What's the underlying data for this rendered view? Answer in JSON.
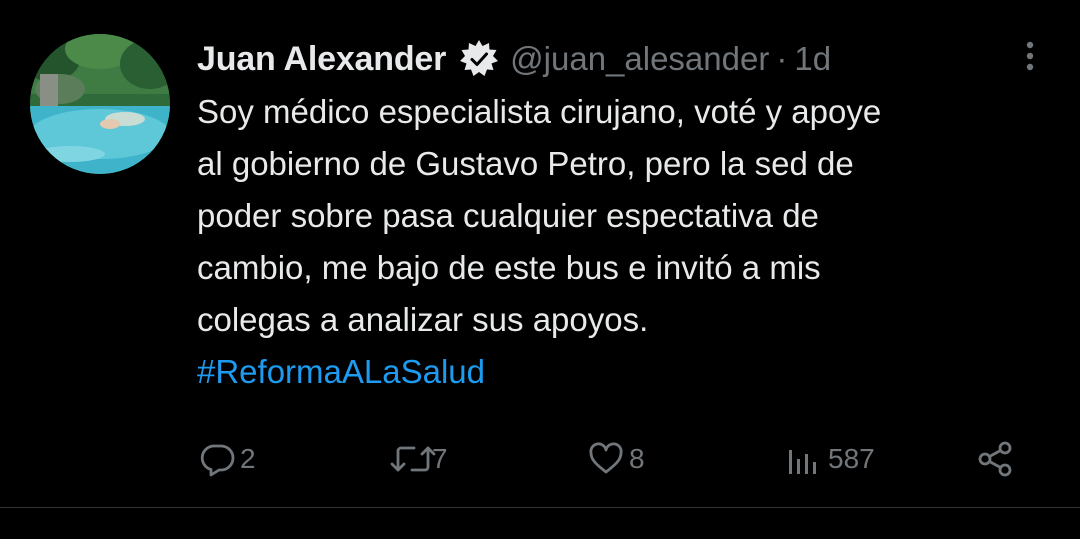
{
  "tweet": {
    "author": {
      "display_name": "Juan Alexander",
      "handle": "@juan_alesander",
      "verified_icon": "verified-badge-icon"
    },
    "separator": "·",
    "time": "1d",
    "body_lines": [
      "Soy médico especialista cirujano, voté y apoye",
      "al gobierno de Gustavo Petro, pero  la sed de",
      "poder sobre pasa cualquier espectativa de",
      "cambio, me bajo de este bus e invitó a mis",
      "colegas a analizar sus apoyos."
    ],
    "hashtag": "#ReformaALaSalud",
    "actions": {
      "reply": {
        "icon": "reply-icon",
        "count": "2"
      },
      "retweet": {
        "icon": "retweet-icon",
        "count": "7"
      },
      "like": {
        "icon": "heart-icon",
        "count": "8"
      },
      "views": {
        "icon": "views-icon",
        "count": "587"
      },
      "share": {
        "icon": "share-icon"
      }
    },
    "more_icon": "more-vertical-icon"
  },
  "colors": {
    "background": "#000000",
    "primary_text": "#e7e9ea",
    "secondary_text": "#71767b",
    "link": "#1d9bf0",
    "divider": "#2f3336"
  }
}
